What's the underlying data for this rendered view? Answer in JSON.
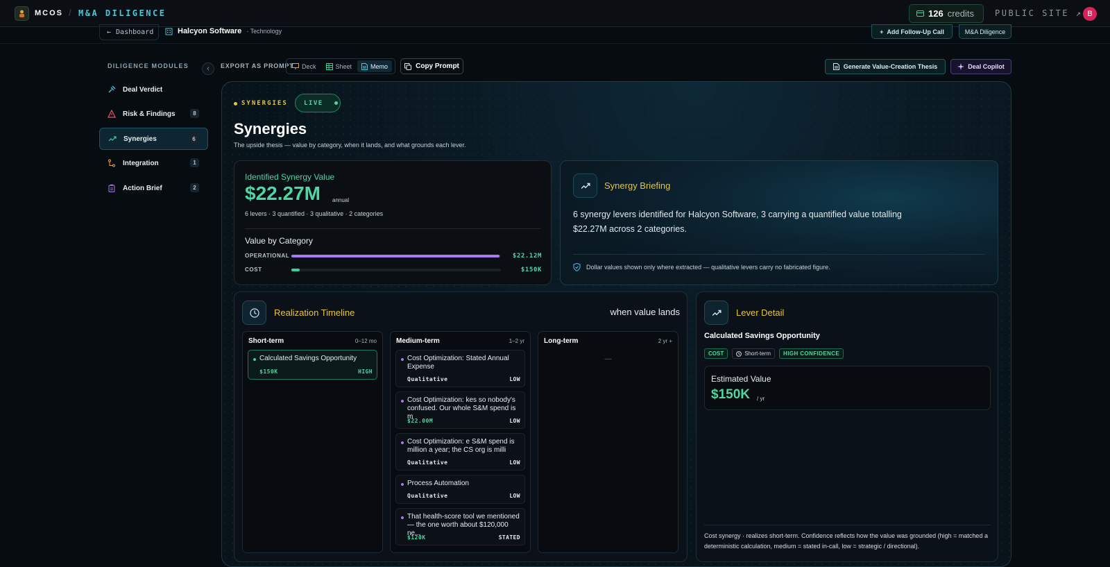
{
  "topbar": {
    "brand": "MCOS",
    "separator": "/",
    "product": "M&A DILIGENCE",
    "credits_value": "126",
    "credits_label": "credits",
    "public_site": "PUBLIC SITE ↗",
    "avatar_letter": "B"
  },
  "subbar": {
    "back_label": "Dashboard",
    "company_name": "Halcyon Software",
    "company_industry": "· Technology",
    "follow_up_label": "Add Follow-Up Call",
    "mode_tag": "M&A Diligence"
  },
  "sidebar": {
    "header": "DILIGENCE MODULES",
    "items": [
      {
        "label": "Deal Verdict",
        "count": ""
      },
      {
        "label": "Risk & Findings",
        "count": "8"
      },
      {
        "label": "Synergies",
        "count": "6"
      },
      {
        "label": "Integration",
        "count": "1"
      },
      {
        "label": "Action Brief",
        "count": "2"
      }
    ]
  },
  "toolbar": {
    "export_label": "EXPORT AS PROMPT",
    "formats": [
      "Deck",
      "Sheet",
      "Memo"
    ],
    "selected_format": "Memo",
    "copy_prompt": "Copy Prompt",
    "generate_thesis": "Generate Value-Creation Thesis",
    "deal_copilot": "Deal Copilot"
  },
  "section": {
    "tag": "SYNERGIES",
    "live": "LIVE",
    "title": "Synergies",
    "subtitle": "The upside thesis — value by category, when it lands, and what grounds each lever."
  },
  "value_card": {
    "label": "Identified Synergy Value",
    "value": "$22.27M",
    "unit": "annual",
    "meta": "6 levers · 3 quantified · 3 qualitative · 2 categories",
    "by_category_title": "Value by Category",
    "categories": [
      {
        "name": "OPERATIONAL",
        "value": "$22.12M",
        "fraction": 0.993,
        "color": "#a779f0"
      },
      {
        "name": "COST",
        "value": "$150K",
        "fraction": 0.04,
        "color": "#34d399"
      }
    ]
  },
  "briefing": {
    "title": "Synergy Briefing",
    "text": "6 synergy levers identified for Halcyon Software, 3 carrying a quantified value totalling $22.27M across 2 categories.",
    "note": "Dollar values shown only where extracted — qualitative levers carry no fabricated figure."
  },
  "timeline": {
    "title": "Realization Timeline",
    "right_label": "when value lands",
    "columns": [
      {
        "name": "Short-term",
        "range": "0–12 mo",
        "empty": "",
        "items": [
          {
            "title": "Calculated Savings Opportunity",
            "value": "$150K",
            "confidence": "HIGH",
            "highlight": true
          }
        ]
      },
      {
        "name": "Medium-term",
        "range": "1–2 yr",
        "empty": "",
        "items": [
          {
            "title": "Cost Optimization: Stated Annual Expense",
            "value": "Qualitative",
            "confidence": "LOW"
          },
          {
            "title": "Cost Optimization: kes so nobody's confused. Our whole S&M spend is m",
            "value": "$22.00M",
            "confidence": "LOW"
          },
          {
            "title": "Cost Optimization: e S&M spend is million a year; the CS org is milli",
            "value": "Qualitative",
            "confidence": "LOW"
          },
          {
            "title": "Process Automation",
            "value": "Qualitative",
            "confidence": "LOW"
          },
          {
            "title": "That health-score tool we mentioned — the one worth about $120,000 ne...",
            "value": "$120K",
            "confidence": "STATED"
          }
        ]
      },
      {
        "name": "Long-term",
        "range": "2 yr +",
        "empty": "—",
        "items": []
      }
    ]
  },
  "lever": {
    "title": "Lever Detail",
    "name": "Calculated Savings Opportunity",
    "chips": [
      "COST",
      "Short-term",
      "HIGH CONFIDENCE"
    ],
    "estimated_label": "Estimated Value",
    "estimated_value": "$150K",
    "estimated_unit": "/ yr",
    "footnote": "Cost synergy · realizes short-term. Confidence reflects how the value was grounded (high = matched a deterministic calculation, medium = stated in-call, low = strategic / directional)."
  },
  "colors": {
    "accent_green": "#4fd6a2",
    "accent_yellow": "#e8c43c",
    "accent_cyan": "#49c8d8",
    "accent_purple": "#a779f0"
  }
}
